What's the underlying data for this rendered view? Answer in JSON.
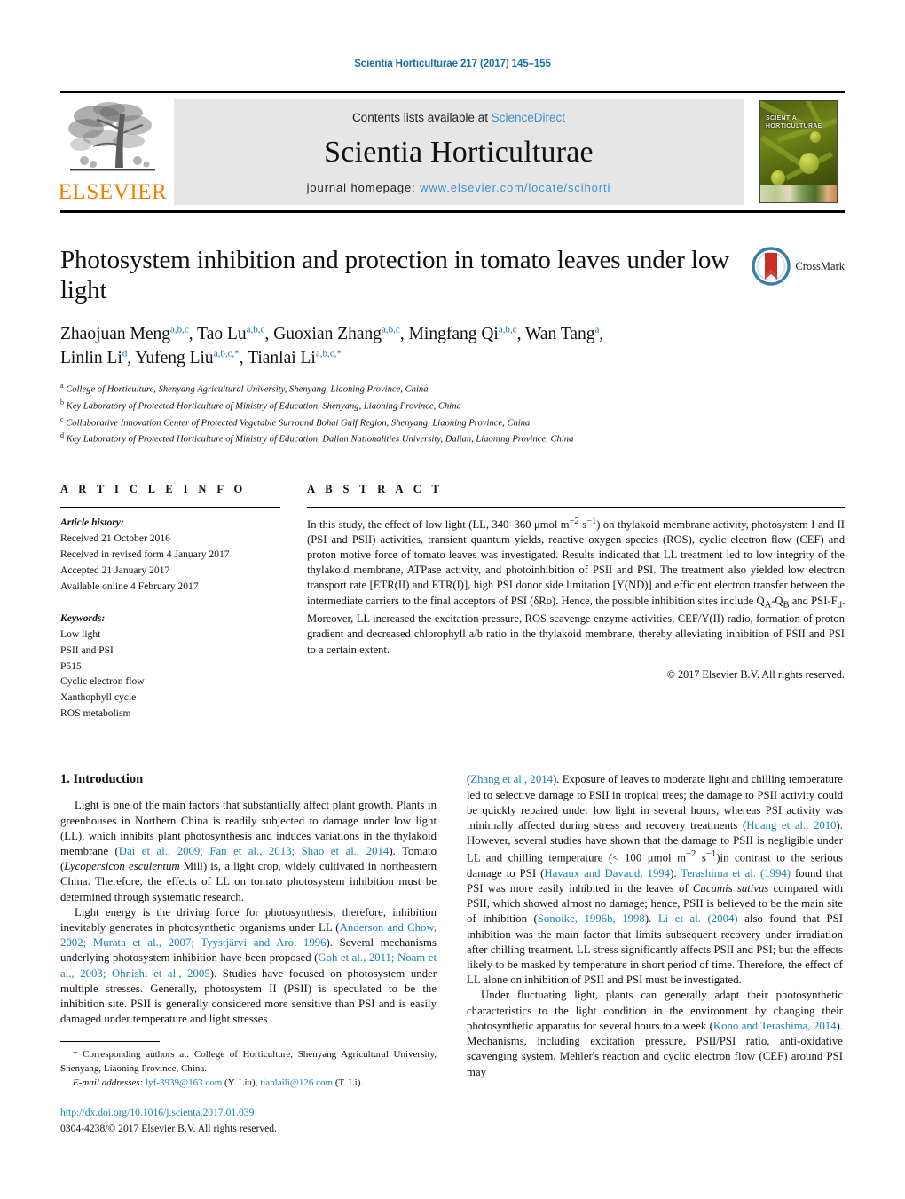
{
  "running_head": "Scientia Horticulturae 217 (2017) 145–155",
  "masthead": {
    "publisher_name": "ELSEVIER",
    "contents_prefix": "Contents lists available at ",
    "contents_link": "ScienceDirect",
    "journal_name": "Scientia Horticulturae",
    "homepage_prefix": "journal homepage: ",
    "homepage_url": "www.elsevier.com/locate/scihorti",
    "cover_title_line1": "SCIENTIA",
    "cover_title_line2": "HORTICULTURAE"
  },
  "article": {
    "title": "Photosystem inhibition and protection in tomato leaves under low light",
    "crossmark_label": "CrossMark",
    "authors_line1": "Zhaojuan Meng<sup>a,b,c</sup>, Tao Lu<sup>a,b,c</sup>, Guoxian Zhang<sup>a,b,c</sup>, Mingfang Qi<sup>a,b,c</sup>, Wan Tang<sup>a</sup>,",
    "authors_line2": "Linlin Li<sup>d</sup>, Yufeng Liu<sup>a,b,c,</sup><sup>*</sup>, Tianlai Li<sup>a,b,c,</sup><sup>*</sup>",
    "affiliations": [
      "<sup>a</sup> College of Horticulture, Shenyang Agricultural University, Shenyang, Liaoning Province, China",
      "<sup>b</sup> Key Laboratory of Protected Horticulture of Ministry of Education, Shenyang, Liaoning Province, China",
      "<sup>c</sup> Collaborative Innovation Center of Protected Vegetable Surround Bohai Gulf Region, Shenyang, Liaoning Province, China",
      "<sup>d</sup> Key Laboratory of Protected Horticulture of Ministry of Education, Dalian Nationalities University, Dalian, Liaoning Province, China"
    ]
  },
  "article_info": {
    "heading": "A R T I C L E   I N F O",
    "history_label": "Article history:",
    "history": [
      "Received 21 October 2016",
      "Received in revised form 4 January 2017",
      "Accepted 21 January 2017",
      "Available online 4 February 2017"
    ],
    "keywords_label": "Keywords:",
    "keywords": [
      "Low light",
      "PSII and PSI",
      "P515",
      "Cyclic electron flow",
      "Xanthophyll cycle",
      "ROS metabolism"
    ]
  },
  "abstract": {
    "heading": "A B S T R A C T",
    "text": "In this study, the effect of low light (LL, 340–360 &#956;mol m<sup>&#8722;2</sup> s<sup>&#8722;1</sup>) on thylakoid membrane activity, photosystem I and II (PSI and PSII) activities, transient quantum yields, reactive oxygen species (ROS), cyclic electron flow (CEF) and proton motive force of tomato leaves was investigated. Results indicated that LL treatment led to low integrity of the thylakoid membrane, ATPase activity, and photoinhibition of PSII and PSI. The treatment also yielded low electron transport rate [ETR(II) and ETR(I)], high PSI donor side limitation [Y(ND)] and efficient electron transfer between the intermediate carriers to the final acceptors of PSI (&#948;Ro). Hence, the possible inhibition sites include Q<sub>A</sub>-Q<sub>B</sub> and PSI-F<sub>d</sub>. Moreover, LL increased the excitation pressure, ROS scavenge enzyme activities, CEF/Y(II) radio, formation of proton gradient and decreased chlorophyll a/b ratio in the thylakoid membrane, thereby alleviating inhibition of PSII and PSI to a certain extent.",
    "copyright": "© 2017 Elsevier B.V. All rights reserved."
  },
  "introduction": {
    "heading": "1.  Introduction",
    "left_paragraphs": [
      "Light is one of the main factors that substantially affect plant growth. Plants in greenhouses in Northern China is readily subjected to damage under low light (LL), which inhibits plant photosynthesis and induces variations in the thylakoid membrane (<span class=\"ref\">Dai et al., 2009; Fan et al., 2013; Shao et al., 2014</span>). Tomato (<span class=\"ital\">Lycopersicon esculentum</span> Mill) is, a light crop, widely cultivated in northeastern China. Therefore, the effects of LL on tomato photosystem inhibition must be determined through systematic research.",
      "Light energy is the driving force for photosynthesis; therefore, inhibition inevitably generates in photosynthetic organisms under LL (<span class=\"ref\">Anderson and Chow, 2002; Murata et al., 2007; Tyystjärvi and Aro, 1996</span>). Several mechanisms underlying photosystem inhibition have been proposed (<span class=\"ref\">Goh et al., 2011; Noam et al., 2003; Ohnishi et al., 2005</span>). Studies have focused on photosystem under multiple stresses. Generally, photosystem II (PSII) is speculated to be the inhibition site. PSII is generally considered more sensitive than PSI and is easily damaged under temperature and light stresses"
    ],
    "right_paragraphs": [
      "(<span class=\"ref\">Zhang et al., 2014</span>). Exposure of leaves to moderate light and chilling temperature led to selective damage to PSII in tropical trees; the damage to PSII activity could be quickly repaired under low light in several hours, whereas PSI activity was minimally affected during stress and recovery treatments (<span class=\"ref\">Huang et al., 2010</span>). However, several studies have shown that the damage to PSII is negligible under LL and chilling temperature (&lt; 100 &#956;mol m<sup>&#8722;2</sup> s<sup>&#8722;1</sup>)in contrast to the serious damage to PSI (<span class=\"ref\">Havaux and Davaud, 1994</span>). <span class=\"ref\">Terashima et al. (1994)</span> found that PSI was more easily inhibited in the leaves of <span class=\"ital\">Cucumis sativus</span> compared with PSII, which showed almost no damage; hence, PSII is believed to be the main site of inhibition (<span class=\"ref\">Sonoike, 1996b, 1998</span>). <span class=\"ref\">Li et al. (2004)</span> also found that PSI inhibition was the main factor that limits subsequent recovery under irradiation after chilling treatment. LL stress significantly affects PSII and PSI; but the effects likely to be masked by temperature in short period of time. Therefore, the effect of LL alone on inhibition of PSII and PSI must be investigated.",
      "Under fluctuating light, plants can generally adapt their photosynthetic characteristics to the light condition in the environment by changing their photosynthetic apparatus for several hours to a week (<span class=\"ref\">Kono and Terashima, 2014</span>). Mechanisms, including excitation pressure, PSII/PSI ratio, anti-oxidative scavenging system, Mehler's reaction and cyclic electron flow (CEF) around PSI may"
    ]
  },
  "footnote": {
    "corresponding": "* Corresponding authors at: College of Horticulture, Shenyang Agricultural University, Shenyang, Liaoning Province, China.",
    "email_label": "E-mail addresses:",
    "email_text": "<span class=\"ref\">lyf-3939@163.com</span> (Y. Liu), <span class=\"ref\">tianlaili@126.com</span> (T. Li).",
    "doi": "http://dx.doi.org/10.1016/j.scienta.2017.01.039",
    "issn": "0304-4238/© 2017 Elsevier B.V. All rights reserved."
  },
  "colors": {
    "link_blue": "#1a7fb5",
    "header_blue": "#1a6ea8",
    "sciencedirect_blue": "#3e8fd0",
    "elsevier_orange": "#f08100",
    "masthead_gray": "#e6e6e6"
  }
}
